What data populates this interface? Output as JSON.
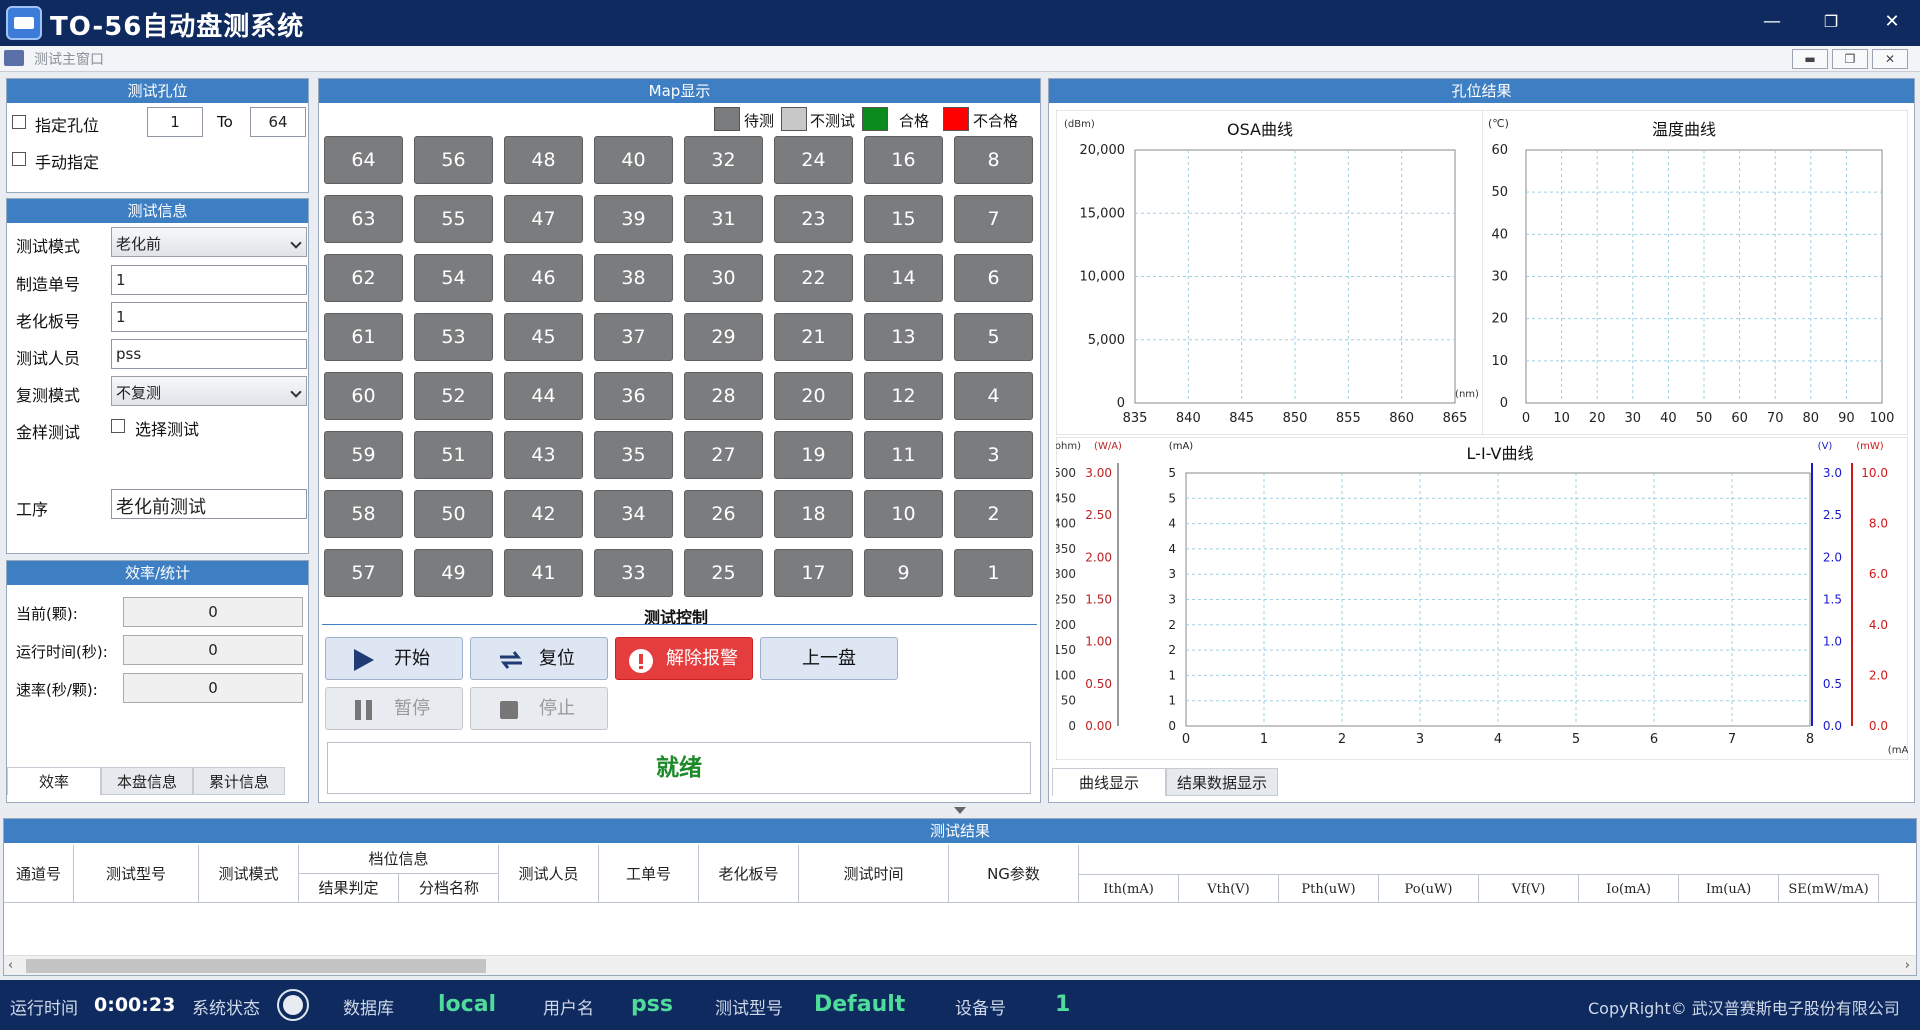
{
  "window": {
    "title": "TO-56自动盘测系统",
    "sub_title": "测试主窗口"
  },
  "hole_panel": {
    "header": "测试孔位",
    "specify_label": "指定孔位",
    "from": "1",
    "to_label": "To",
    "to": "64",
    "manual_label": "手动指定"
  },
  "info_panel": {
    "header": "测试信息",
    "mode_label": "测试模式",
    "mode_value": "老化前",
    "order_label": "制造单号",
    "order_value": "1",
    "board_label": "老化板号",
    "board_value": "1",
    "tester_label": "测试人员",
    "tester_value": "pss",
    "retest_label": "复测模式",
    "retest_value": "不复测",
    "golden_label": "金样测试",
    "golden_check": "选择测试",
    "process_label": "工序",
    "process_value": "老化前测试"
  },
  "stats_panel": {
    "header": "效率/统计",
    "current_label": "当前(颗):",
    "current_value": "0",
    "runtime_label": "运行时间(秒):",
    "runtime_value": "0",
    "rate_label": "速率(秒/颗):",
    "rate_value": "0",
    "tabs": [
      "效率",
      "本盘信息",
      "累计信息"
    ]
  },
  "map_panel": {
    "header": "Map显示",
    "legend": [
      {
        "label": "待测",
        "color": "#7b7c7e"
      },
      {
        "label": "不测试",
        "color": "#c8c8c8"
      },
      {
        "label": "合格",
        "color": "#0b8a1e"
      },
      {
        "label": "不合格",
        "color": "#ff0000"
      }
    ],
    "rows": [
      [
        "64",
        "56",
        "48",
        "40",
        "32",
        "24",
        "16",
        "8"
      ],
      [
        "63",
        "55",
        "47",
        "39",
        "31",
        "23",
        "15",
        "7"
      ],
      [
        "62",
        "54",
        "46",
        "38",
        "30",
        "22",
        "14",
        "6"
      ],
      [
        "61",
        "53",
        "45",
        "37",
        "29",
        "21",
        "13",
        "5"
      ],
      [
        "60",
        "52",
        "44",
        "36",
        "28",
        "20",
        "12",
        "4"
      ],
      [
        "59",
        "51",
        "43",
        "35",
        "27",
        "19",
        "11",
        "3"
      ],
      [
        "58",
        "50",
        "42",
        "34",
        "26",
        "18",
        "10",
        "2"
      ],
      [
        "57",
        "49",
        "41",
        "33",
        "25",
        "17",
        "9",
        "1"
      ]
    ]
  },
  "control": {
    "header": "测试控制",
    "start": "开始",
    "reset": "复位",
    "alarm": "解除报警",
    "prev": "上一盘",
    "pause": "暂停",
    "stop": "停止",
    "status": "就绪"
  },
  "results_panel": {
    "header": "孔位结果",
    "tabs": [
      "曲线显示",
      "结果数据显示"
    ]
  },
  "chart_data": [
    {
      "type": "line",
      "title": "OSA曲线",
      "ylabel": "(dBm)",
      "xlabel": "(nm)",
      "ylim": [
        0,
        20000
      ],
      "xlim": [
        835,
        865
      ],
      "xticks": [
        "835",
        "840",
        "845",
        "850",
        "855",
        "860",
        "865"
      ],
      "yticks": [
        "0",
        "5,000",
        "10,000",
        "15,000",
        "20,000"
      ],
      "series": []
    },
    {
      "type": "line",
      "title": "温度曲线",
      "ylabel": "(℃)",
      "ylim": [
        0,
        60
      ],
      "xlim": [
        0,
        100
      ],
      "xticks": [
        "0",
        "10",
        "20",
        "30",
        "40",
        "50",
        "60",
        "70",
        "80",
        "90",
        "100"
      ],
      "yticks": [
        "0",
        "10",
        "20",
        "30",
        "40",
        "50",
        "60"
      ],
      "series": []
    },
    {
      "type": "line",
      "title": "L-I-V曲线",
      "xlabel": "(mA)",
      "xlim": [
        0,
        8
      ],
      "xticks": [
        "0",
        "1",
        "2",
        "3",
        "4",
        "5",
        "6",
        "7",
        "8"
      ],
      "axes": [
        {
          "unit": "(ohm)",
          "ticks": [
            "0",
            "50",
            "100",
            "150",
            "200",
            "250",
            "300",
            "350",
            "400",
            "450",
            "500"
          ]
        },
        {
          "unit": "(W/A)",
          "ticks": [
            "0.00",
            "0.50",
            "1.00",
            "1.50",
            "2.00",
            "2.50",
            "3.00"
          ]
        },
        {
          "unit": "(mA)",
          "ticks": [
            "0",
            "1",
            "1",
            "2",
            "2",
            "3",
            "3",
            "4",
            "4",
            "5",
            "5"
          ]
        },
        {
          "unit": "(V)",
          "ticks": [
            "0.0",
            "0.5",
            "1.0",
            "1.5",
            "2.0",
            "2.5",
            "3.0"
          ]
        },
        {
          "unit": "(mW)",
          "ticks": [
            "0.0",
            "2.0",
            "4.0",
            "6.0",
            "8.0",
            "10.0"
          ]
        }
      ],
      "series": []
    }
  ],
  "test_results": {
    "header": "测试结果",
    "columns": [
      "通道号",
      "测试型号",
      "测试模式",
      "档位信息",
      "测试人员",
      "工单号",
      "老化板号",
      "测试时间",
      "NG参数"
    ],
    "grade_sub": [
      "结果判定",
      "分档名称"
    ],
    "params": [
      "Ith(mA)",
      "Vth(V)",
      "Pth(uW)",
      "Po(uW)",
      "Vf(V)",
      "Io(mA)",
      "Im(uA)",
      "SE(mW/mA)"
    ]
  },
  "statusbar": {
    "runtime_label": "运行时间",
    "runtime": "0:00:23",
    "sys_label": "系统状态",
    "db_label": "数据库",
    "db": "local",
    "user_label": "用户名",
    "user": "pss",
    "model_label": "测试型号",
    "model": "Default",
    "device_label": "设备号",
    "device": "1",
    "copyright": "CopyRight© 武汉普赛斯电子股份有限公司"
  }
}
